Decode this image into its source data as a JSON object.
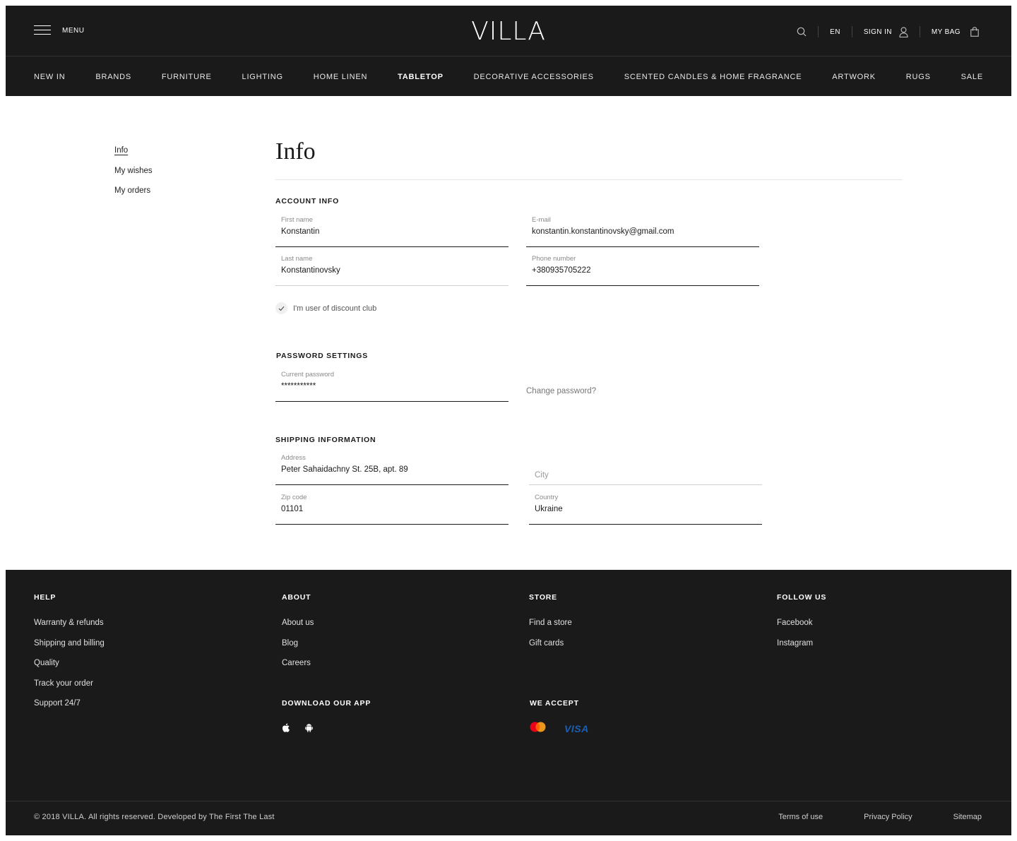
{
  "header": {
    "menu_label": "MENU",
    "logo": "VILLA",
    "language": "EN",
    "sign_in": "SIGN IN",
    "my_bag": "MY BAG"
  },
  "nav": {
    "items": [
      {
        "label": "NEW IN"
      },
      {
        "label": "BRANDS"
      },
      {
        "label": "FURNITURE"
      },
      {
        "label": "LIGHTING"
      },
      {
        "label": "HOME LINEN"
      },
      {
        "label": "TABLETOP",
        "active": true
      },
      {
        "label": "DECORATIVE ACCESSORIES"
      },
      {
        "label": "SCENTED CANDLES & HOME FRAGRANCE"
      },
      {
        "label": "ARTWORK"
      },
      {
        "label": "RUGS"
      },
      {
        "label": "SALE"
      }
    ]
  },
  "sidebar": {
    "items": [
      {
        "label": "Info",
        "active": true
      },
      {
        "label": "My wishes"
      },
      {
        "label": "My orders"
      }
    ]
  },
  "main": {
    "title": "Info",
    "account": {
      "heading": "ACCOUNT INFO",
      "first_name": {
        "label": "First name",
        "value": "Konstantin"
      },
      "email": {
        "label": "E-mail",
        "value": "konstantin.konstantinovsky@gmail.com"
      },
      "last_name": {
        "label": "Last name",
        "value": "Konstantinovsky"
      },
      "phone": {
        "label": "Phone number",
        "value": "+380935705222"
      },
      "discount_club": {
        "label": "I'm user of discount club",
        "checked": true
      }
    },
    "password": {
      "heading": "PASSWORD SETTINGS",
      "current": {
        "label": "Current password",
        "value": "***********"
      },
      "change_link": "Change password?"
    },
    "shipping": {
      "heading": "SHIPPING INFORMATION",
      "address": {
        "label": "Address",
        "value": "Peter Sahaidachny St. 25B, apt. 89"
      },
      "city": {
        "placeholder": "City"
      },
      "zip": {
        "label": "Zip code",
        "value": "01101"
      },
      "country": {
        "label": "Country",
        "value": "Ukraine"
      }
    }
  },
  "footer": {
    "help": {
      "heading": "HELP",
      "links": [
        "Warranty & refunds",
        "Shipping and billing",
        "Quality",
        "Track your order",
        "Support 24/7"
      ]
    },
    "about": {
      "heading": "ABOUT",
      "links": [
        "About us",
        "Blog",
        "Careers"
      ]
    },
    "store": {
      "heading": "STORE",
      "links": [
        "Find a store",
        "Gift cards"
      ]
    },
    "follow": {
      "heading": "FOLLOW US",
      "links": [
        "Facebook",
        "Instagram"
      ]
    },
    "app": {
      "heading": "DOWNLOAD OUR APP",
      "icons": [
        "apple-icon",
        "android-icon"
      ]
    },
    "accept": {
      "heading": "WE ACCEPT",
      "icons": [
        "mastercard-icon",
        "visa-icon"
      ],
      "visa_label": "VISA"
    },
    "copyright": "© 2018 VILLA. All rights reserved. Developed by The First The Last",
    "legal": [
      "Terms of use",
      "Privacy Policy",
      "Sitemap"
    ]
  },
  "colors": {
    "header_bg": "#1a1a1a",
    "footer_bg": "#1a1a1a",
    "mastercard_red": "#eb001b",
    "mastercard_orange": "#f79e1b",
    "visa_blue": "#1a5fb4"
  }
}
